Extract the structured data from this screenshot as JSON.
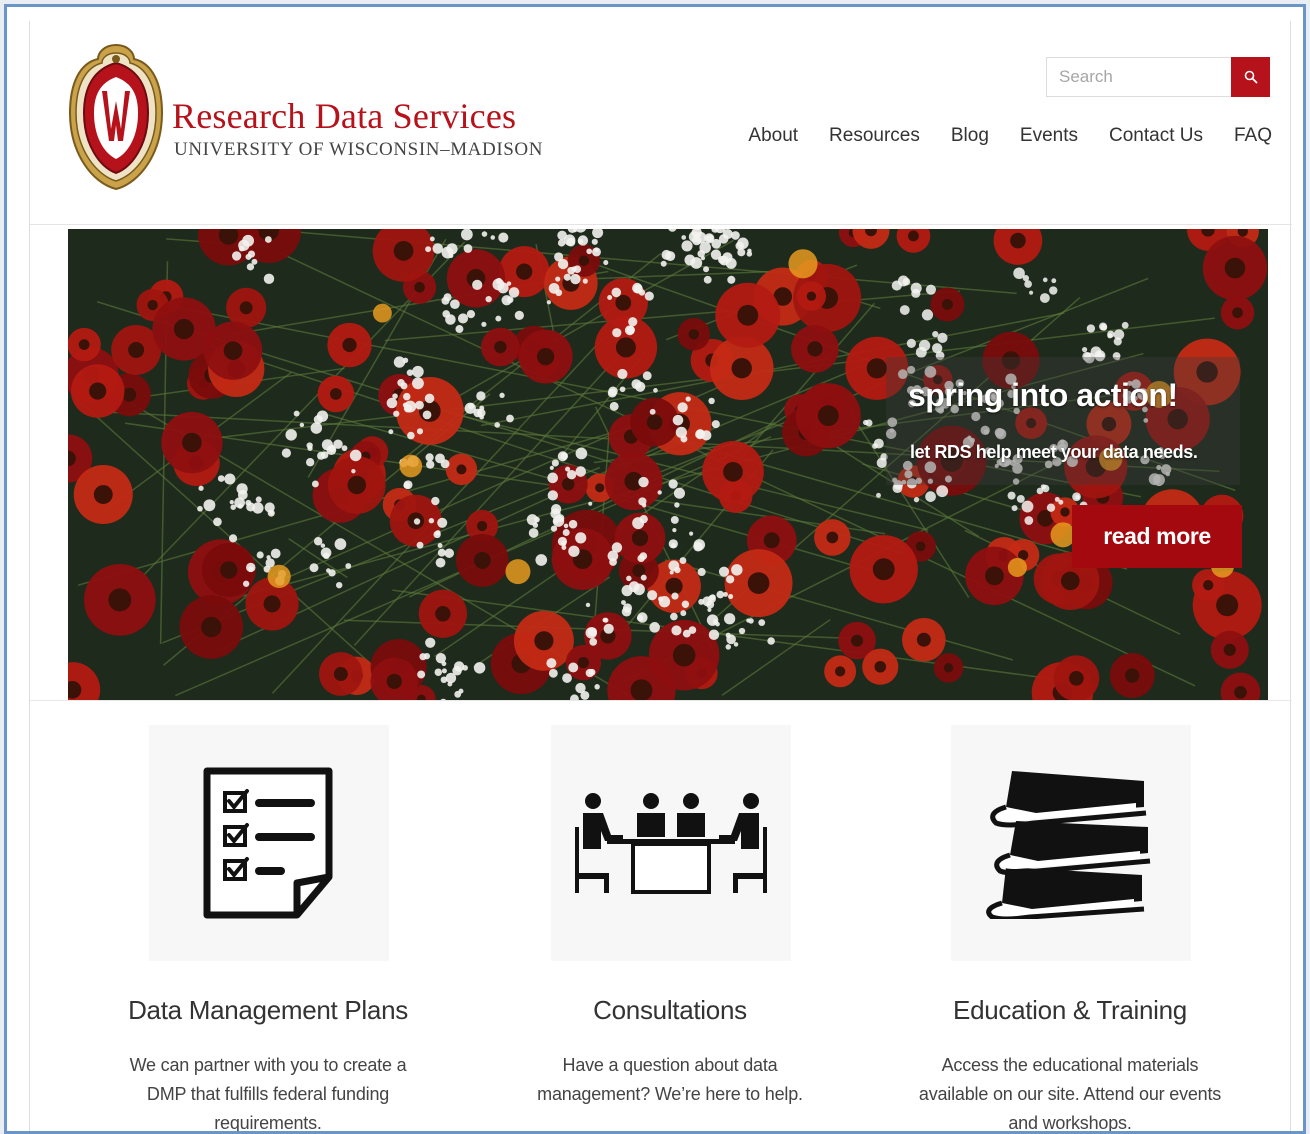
{
  "header": {
    "brand_title": "Research Data Services",
    "brand_subtitle": "UNIVERSITY OF WISCONSIN–MADISON",
    "search_placeholder": "Search",
    "search_icon": "search-icon"
  },
  "nav": {
    "items": [
      "About",
      "Resources",
      "Blog",
      "Events",
      "Contact Us",
      "FAQ"
    ]
  },
  "hero": {
    "title": "spring into action!",
    "subtitle": "let RDS help meet your data needs.",
    "button_label": "read more"
  },
  "features": [
    {
      "icon": "checklist-icon",
      "title": "Data Management Plans",
      "text": "We can partner with you to create a DMP that fulfills federal funding requirements."
    },
    {
      "icon": "meeting-icon",
      "title": "Consultations",
      "text": "Have a question about data management? We’re here to help."
    },
    {
      "icon": "books-icon",
      "title": "Education & Training",
      "text": "Access the educational materials available on our site. Attend our events and workshops."
    }
  ],
  "colors": {
    "brand_red": "#b5121b",
    "button_red": "#a4090f",
    "frame_blue": "#6b95c7"
  }
}
